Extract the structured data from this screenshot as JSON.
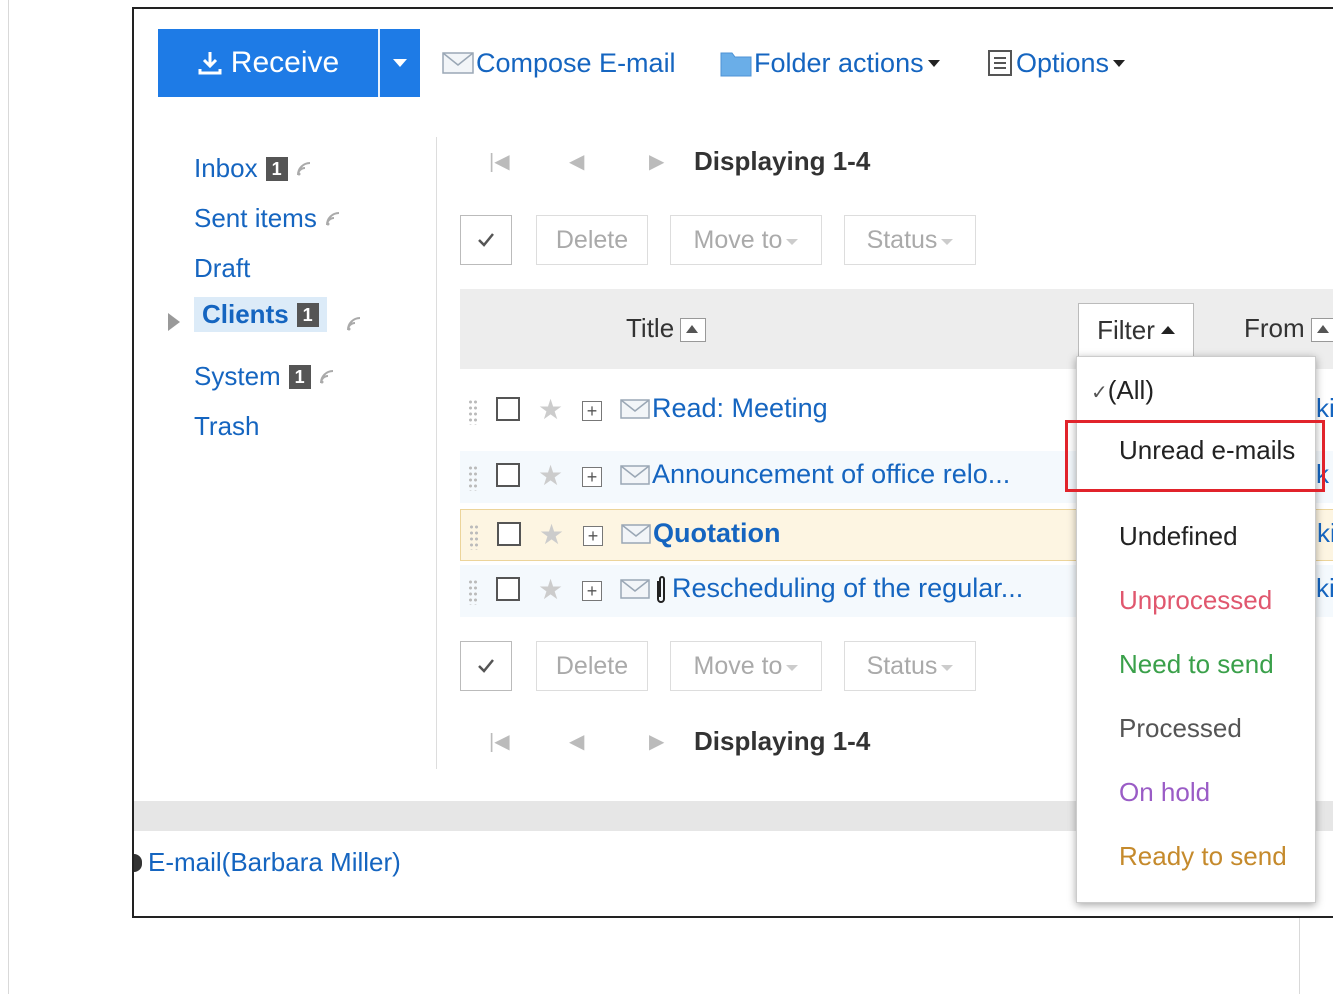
{
  "toolbar": {
    "receive_label": "Receive",
    "compose_label": "Compose E-mail",
    "folder_actions_label": "Folder actions",
    "options_label": "Options"
  },
  "folders": [
    {
      "label": "Inbox",
      "badge": "1"
    },
    {
      "label": "Sent items"
    },
    {
      "label": "Draft"
    },
    {
      "label": "Clients",
      "badge": "1"
    },
    {
      "label": "System",
      "badge": "1"
    },
    {
      "label": "Trash"
    }
  ],
  "pager": {
    "displaying": "Displaying 1-4"
  },
  "actions": {
    "delete": "Delete",
    "move_to": "Move to",
    "status": "Status"
  },
  "table": {
    "headers": {
      "title": "Title",
      "filter": "Filter",
      "from": "From"
    },
    "rows": [
      {
        "subject": "Read: Meeting",
        "edge": "ki"
      },
      {
        "subject": "Announcement of office relo...",
        "edge": "k"
      },
      {
        "subject": "Quotation",
        "edge": "ki"
      },
      {
        "subject": "Rescheduling of the regular...",
        "edge": "ki"
      }
    ]
  },
  "filter_menu": {
    "all": "(All)",
    "items": [
      "Unread e-mails",
      "Undefined",
      "Unprocessed",
      "Need to send",
      "Processed",
      "On hold",
      "Ready to send"
    ],
    "colors": [
      "#222222",
      "#222222",
      "#e0576e",
      "#3aa04a",
      "#555555",
      "#9a5cc6",
      "#c58a2c"
    ]
  },
  "footer": {
    "link": "E-mail(Barbara Miller)"
  }
}
